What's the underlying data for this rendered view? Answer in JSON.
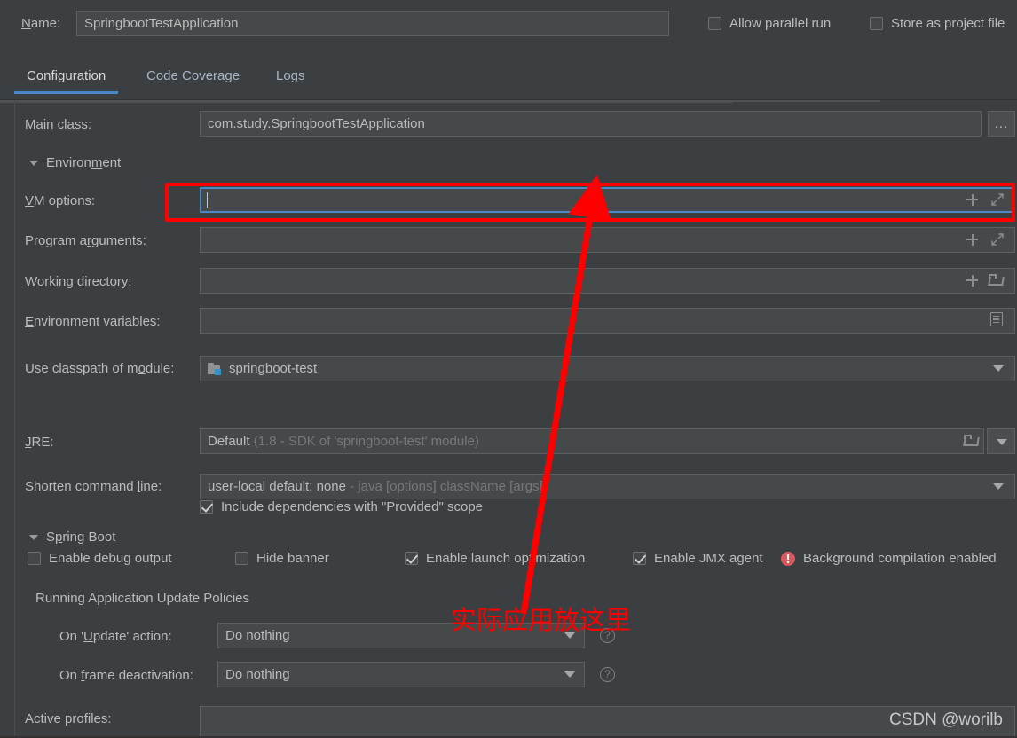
{
  "window": {
    "name_label": "Name:",
    "name_value": "SpringbootTestApplication",
    "allow_parallel_run": "Allow parallel run",
    "store_as_project_file": "Store as project file"
  },
  "tabs": [
    {
      "label": "Configuration",
      "active": true
    },
    {
      "label": "Code Coverage",
      "active": false
    },
    {
      "label": "Logs",
      "active": false
    }
  ],
  "form": {
    "main_class_label": "Main class:",
    "main_class_value": "com.study.SpringbootTestApplication",
    "browse_button": "...",
    "environment_section": "Environment",
    "vm_options_label": "VM options:",
    "vm_options_value": "",
    "program_arguments_label": "Program arguments:",
    "program_arguments_value": "",
    "working_directory_label": "Working directory:",
    "working_directory_value": "",
    "environment_variables_label": "Environment variables:",
    "environment_variables_value": "",
    "use_classpath_label": "Use classpath of module:",
    "use_classpath_value": "springboot-test",
    "include_provided_label": "Include dependencies with \"Provided\" scope",
    "include_provided_checked": true,
    "jre_label": "JRE:",
    "jre_value": "Default",
    "jre_value_muted": "(1.8 - SDK of 'springboot-test' module)",
    "shorten_cmd_label": "Shorten command line:",
    "shorten_cmd_value": "user-local default: none",
    "shorten_cmd_muted": "- java [options] className [args]"
  },
  "spring_boot": {
    "section_label": "Spring Boot",
    "checkboxes": [
      {
        "label": "Enable debug output",
        "checked": false
      },
      {
        "label": "Hide banner",
        "checked": false
      },
      {
        "label": "Enable launch optimization",
        "checked": true
      },
      {
        "label": "Enable JMX agent",
        "checked": true
      }
    ],
    "background_compilation_warning": "Background compilation enabled",
    "update_policies_label": "Running Application Update Policies",
    "on_update_action_label": "On 'Update' action:",
    "on_update_action_value": "Do nothing",
    "on_frame_deactivation_label": "On frame deactivation:",
    "on_frame_deactivation_value": "Do nothing",
    "help_icon_label": "?",
    "active_profiles_label": "Active profiles:",
    "active_profiles_value": ""
  },
  "annotations": {
    "callout_text": "实际应用放这里",
    "highlight_color": "#fe0000",
    "watermark": "CSDN @worilb"
  }
}
